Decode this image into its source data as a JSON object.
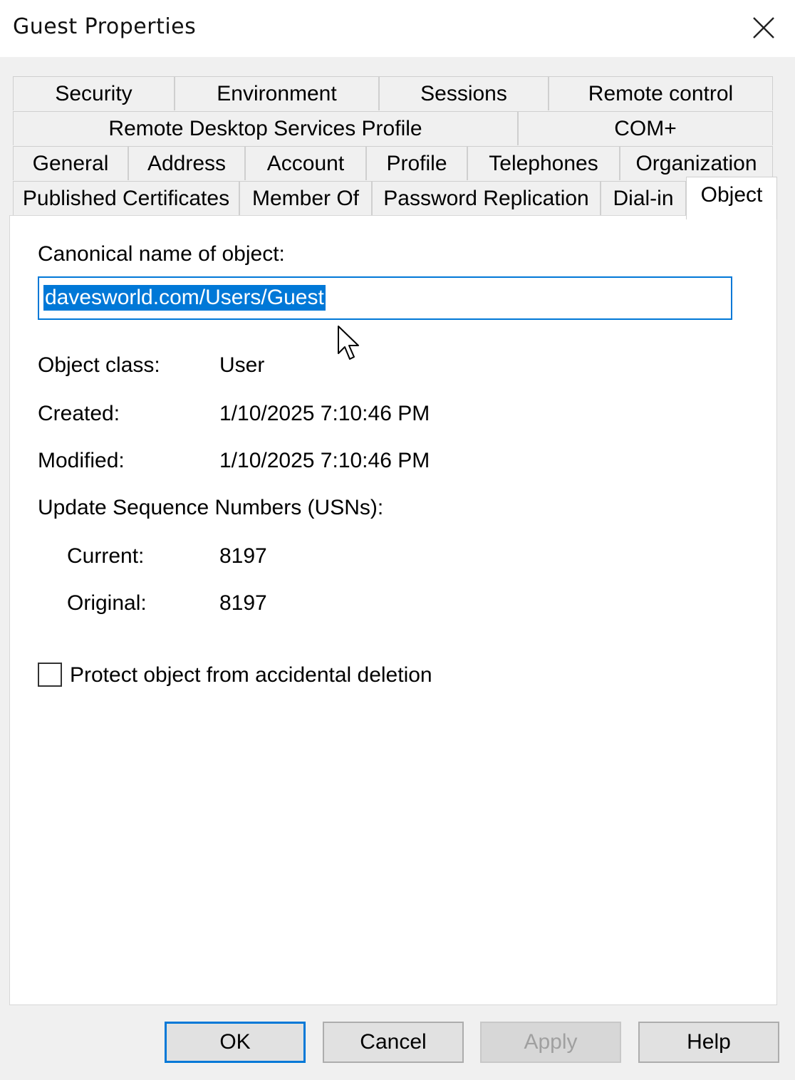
{
  "window": {
    "title": "Guest Properties"
  },
  "tabs": {
    "row1": [
      "Security",
      "Environment",
      "Sessions",
      "Remote control"
    ],
    "row2": [
      "Remote Desktop Services Profile",
      "COM+"
    ],
    "row3": [
      "General",
      "Address",
      "Account",
      "Profile",
      "Telephones",
      "Organization"
    ],
    "row4": [
      "Published Certificates",
      "Member Of",
      "Password Replication",
      "Dial-in",
      "Object"
    ],
    "active": "Object"
  },
  "object_tab": {
    "canonical_label": "Canonical name of object:",
    "canonical_value": "davesworld.com/Users/Guest",
    "object_class_label": "Object class:",
    "object_class_value": "User",
    "created_label": "Created:",
    "created_value": "1/10/2025 7:10:46 PM",
    "modified_label": "Modified:",
    "modified_value": "1/10/2025 7:10:46 PM",
    "usn_label": "Update Sequence Numbers (USNs):",
    "current_label": "Current:",
    "current_value": "8197",
    "original_label": "Original:",
    "original_value": "8197",
    "protect_label": "Protect object from accidental deletion",
    "protect_checked": false
  },
  "buttons": {
    "ok": "OK",
    "cancel": "Cancel",
    "apply": "Apply",
    "help": "Help"
  }
}
